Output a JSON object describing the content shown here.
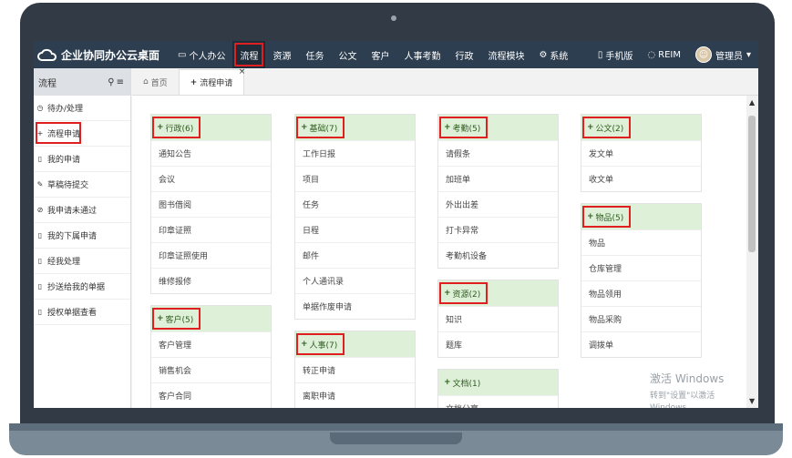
{
  "app": {
    "title": "企业协同办公云桌面"
  },
  "topnav": {
    "items": [
      {
        "label": "个人办公",
        "icon": "monitor-icon"
      },
      {
        "label": "流程",
        "active": true
      },
      {
        "label": "资源"
      },
      {
        "label": "任务"
      },
      {
        "label": "公文"
      },
      {
        "label": "客户"
      },
      {
        "label": "人事考勤"
      },
      {
        "label": "行政"
      },
      {
        "label": "流程模块"
      },
      {
        "label": "系统",
        "icon": "gear-icon"
      }
    ],
    "mobile_label": "手机版",
    "reim_label": "REIM",
    "user_label": "管理员",
    "user_caret": "▾"
  },
  "sidebar": {
    "title": "流程",
    "items": [
      {
        "label": "待办/处理",
        "icon": "clock-icon"
      },
      {
        "label": "流程申请",
        "icon": "plus-icon"
      },
      {
        "label": "我的申请",
        "icon": "bookmark-icon"
      },
      {
        "label": "草稿待提交",
        "icon": "edit-icon"
      },
      {
        "label": "我申请未通过",
        "icon": "ban-icon"
      },
      {
        "label": "我的下属申请",
        "icon": "bookmark-icon"
      },
      {
        "label": "经我处理",
        "icon": "bookmark-icon"
      },
      {
        "label": "抄送给我的单据",
        "icon": "bookmark-icon"
      },
      {
        "label": "授权单据查看",
        "icon": "bookmark-icon"
      }
    ]
  },
  "tabs": [
    {
      "label": "首页",
      "icon": "home-icon"
    },
    {
      "label": "流程申请",
      "active": true,
      "close": "×"
    }
  ],
  "panels": [
    {
      "title": "行政(6)",
      "items": [
        "通知公告",
        "会议",
        "图书借阅",
        "印章证照",
        "印章证照使用",
        "维修报修"
      ]
    },
    {
      "title": "客户(5)",
      "items": [
        "客户管理",
        "销售机会",
        "客户合同"
      ]
    },
    {
      "title": "基础(7)",
      "items": [
        "工作日报",
        "项目",
        "任务",
        "日程",
        "邮件",
        "个人通讯录",
        "单据作废申请"
      ]
    },
    {
      "title": "人事(7)",
      "items": [
        "转正申请",
        "离职申请"
      ]
    },
    {
      "title": "考勤(5)",
      "items": [
        "请假条",
        "加班单",
        "外出出差",
        "打卡异常",
        "考勤机设备"
      ]
    },
    {
      "title": "资源(2)",
      "items": [
        "知识",
        "题库"
      ]
    },
    {
      "title": "文档(1)",
      "items": [
        "文档分享"
      ]
    },
    {
      "title": "公文(2)",
      "items": [
        "发文单",
        "收文单"
      ]
    },
    {
      "title": "物品(5)",
      "items": [
        "物品",
        "仓库管理",
        "物品领用",
        "物品采购",
        "调拨单"
      ]
    }
  ],
  "watermark": {
    "title": "激活 Windows",
    "subtitle": "转到\"设置\"以激活 Windows。"
  },
  "colors": {
    "nav": "#2d3e50",
    "panel_head": "#dff0d8",
    "highlight": "#e02020"
  }
}
